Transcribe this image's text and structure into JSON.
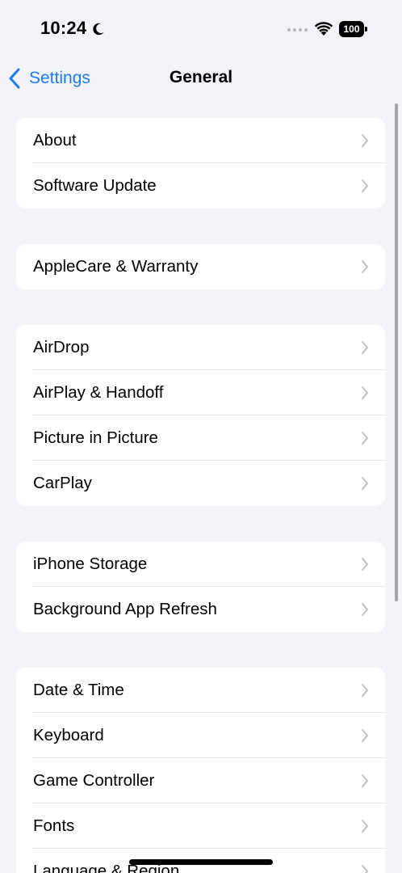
{
  "status_bar": {
    "time": "10:24",
    "focus_icon": "moon-icon",
    "wifi_icon": "wifi-icon",
    "battery_level": "100"
  },
  "nav": {
    "back_label": "Settings",
    "title": "General"
  },
  "groups": [
    {
      "items": [
        {
          "label": "About"
        },
        {
          "label": "Software Update"
        }
      ]
    },
    {
      "items": [
        {
          "label": "AppleCare & Warranty"
        }
      ]
    },
    {
      "items": [
        {
          "label": "AirDrop"
        },
        {
          "label": "AirPlay & Handoff"
        },
        {
          "label": "Picture in Picture"
        },
        {
          "label": "CarPlay"
        }
      ]
    },
    {
      "items": [
        {
          "label": "iPhone Storage"
        },
        {
          "label": "Background App Refresh"
        }
      ]
    },
    {
      "items": [
        {
          "label": "Date & Time"
        },
        {
          "label": "Keyboard"
        },
        {
          "label": "Game Controller"
        },
        {
          "label": "Fonts"
        },
        {
          "label": "Language & Region"
        }
      ]
    }
  ],
  "colors": {
    "accent": "#1a7cf5",
    "background": "#f2f2f7",
    "chevron": "#c4c4c7"
  }
}
